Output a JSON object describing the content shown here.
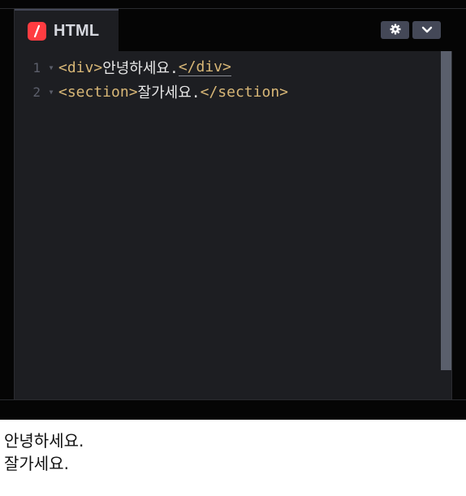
{
  "editor": {
    "tab": {
      "label": "HTML",
      "icon": "html-language-icon",
      "icon_color": "#ff3c41"
    },
    "buttons": {
      "settings_icon": "gear-icon",
      "dropdown_icon": "chevron-down-icon"
    },
    "lines": [
      {
        "number": "1",
        "open_tag": "<div>",
        "text": "안녕하세요.",
        "close_tag": "</div>"
      },
      {
        "number": "2",
        "open_tag": "<section>",
        "text": "잘가세요.",
        "close_tag": "</section>"
      }
    ],
    "colors": {
      "background": "#1d1e22",
      "tag": "#d8b777",
      "text": "#e8e8e8",
      "line_number": "#5c5f6b",
      "button": "#444857"
    }
  },
  "preview": {
    "lines": [
      "안녕하세요.",
      "잘가세요."
    ]
  }
}
